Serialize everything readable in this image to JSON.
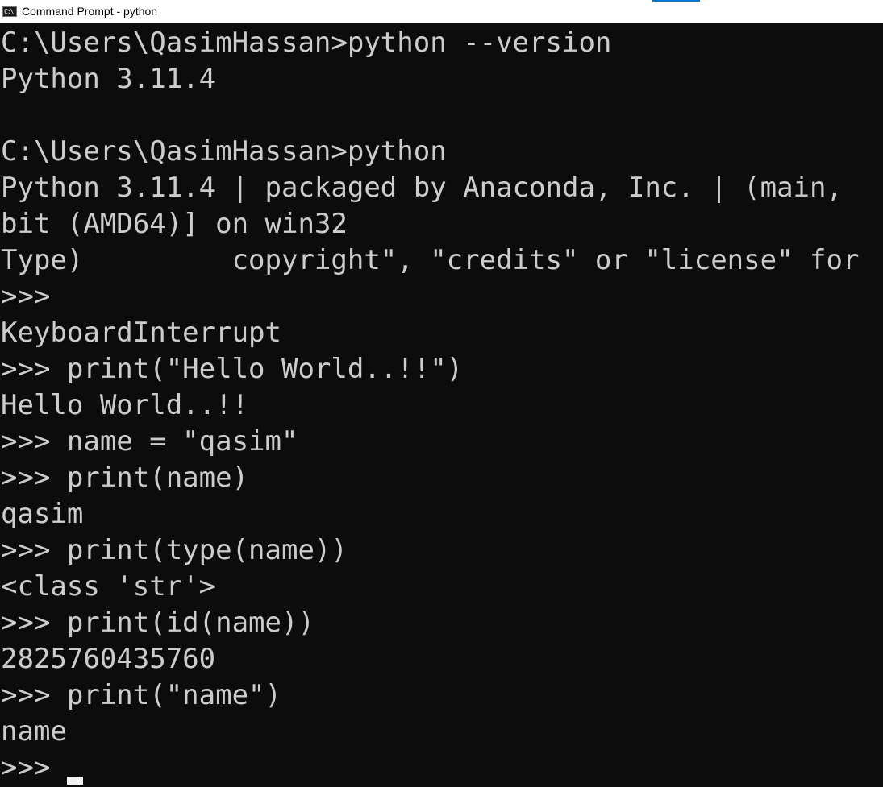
{
  "window": {
    "title": "Command Prompt - python",
    "icon": "cmd-icon",
    "icon_glyph": "C:\\",
    "accent_color": "#0078d7",
    "background_color": "#0c0c0c",
    "text_color": "#cccccc"
  },
  "console": {
    "lines": [
      "C:\\Users\\QasimHassan>python --version",
      "Python 3.11.4",
      "",
      "C:\\Users\\QasimHassan>python",
      "Python 3.11.4 | packaged by Anaconda, Inc. | (main,",
      "bit (AMD64)] on win32",
      "Type)         copyright\", \"credits\" or \"license\" for",
      ">>>",
      "KeyboardInterrupt",
      ">>> print(\"Hello World..!!\")",
      "Hello World..!!",
      ">>> name = \"qasim\"",
      ">>> print(name)",
      "qasim",
      ">>> print(type(name))",
      "<class 'str'>",
      ">>> print(id(name))",
      "2825760435760",
      ">>> print(\"name\")",
      "name"
    ],
    "current_prompt": ">>> "
  }
}
